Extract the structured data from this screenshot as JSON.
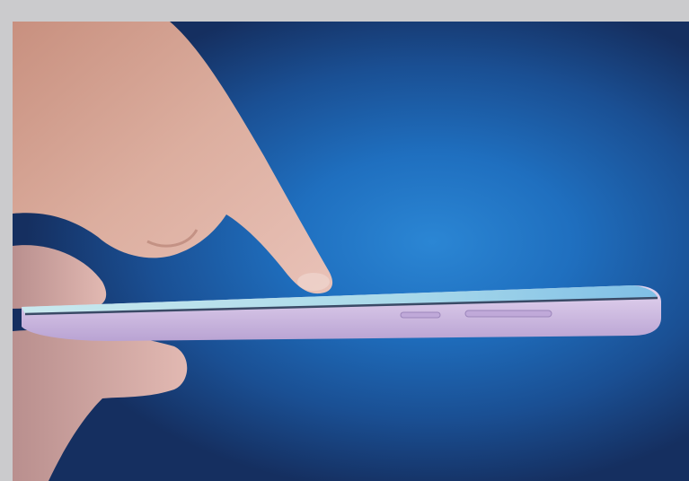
{
  "image": {
    "subject": "finger-touching-smartphone",
    "colors": {
      "background_center": "#2b86d4",
      "background_edge": "#152f60",
      "frame": "#cbcbcd",
      "phone_body": "#d7c7e6",
      "phone_screen": "#bfe6ef",
      "skin": "#d9a99a"
    }
  }
}
